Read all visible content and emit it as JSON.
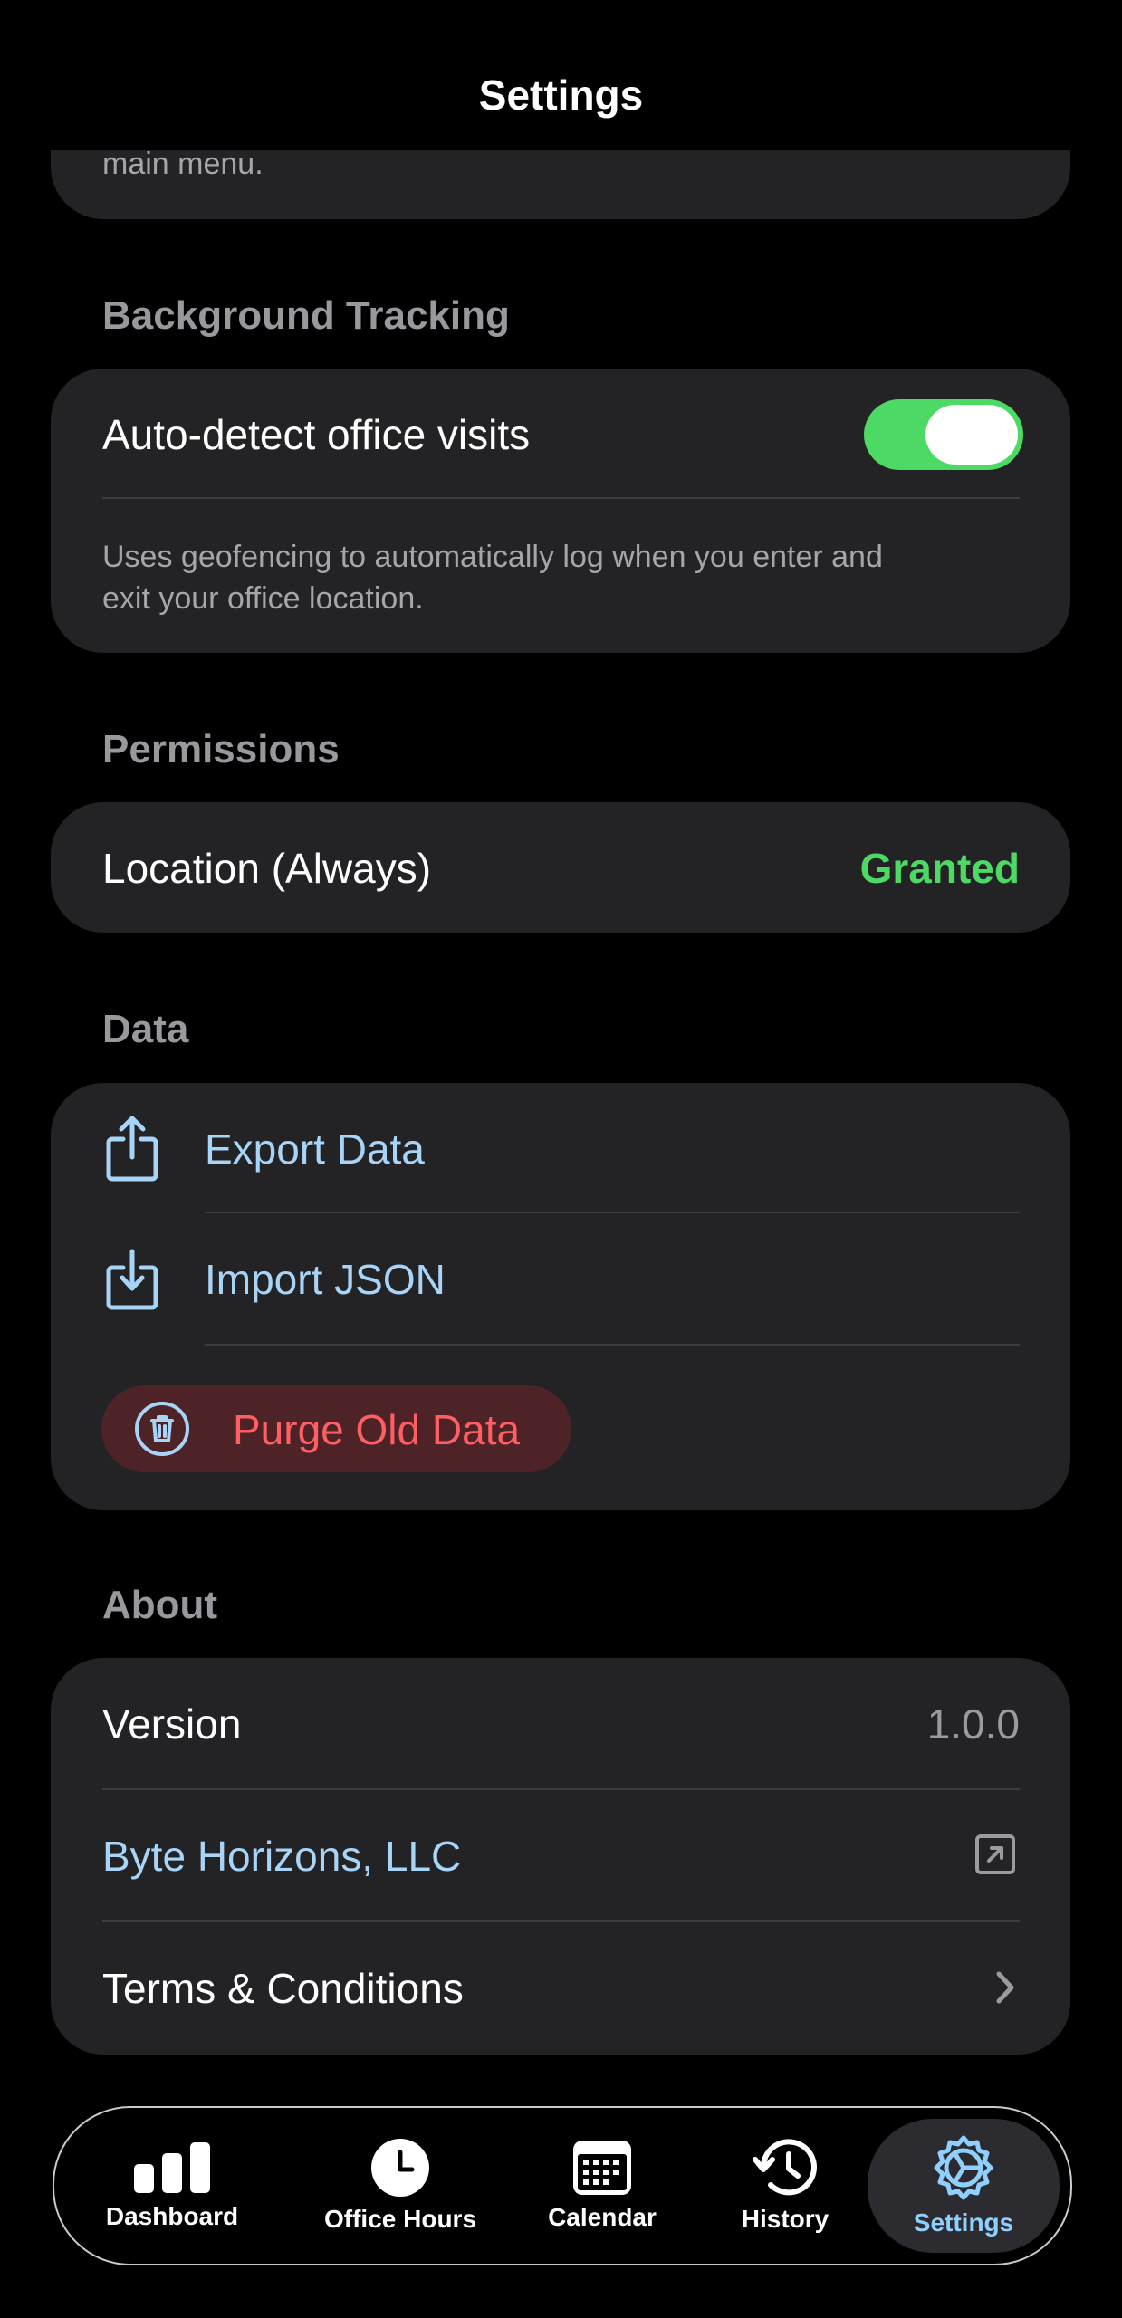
{
  "header": {
    "title": "Settings"
  },
  "top_card": {
    "clipped_text": "main menu."
  },
  "background_tracking": {
    "header": "Background Tracking",
    "toggle_label": "Auto-detect office visits",
    "toggle_on": true,
    "description_line1": "Uses geofencing to automatically log when you enter and",
    "description_line2": "exit your office location."
  },
  "permissions": {
    "header": "Permissions",
    "label": "Location (Always)",
    "status": "Granted",
    "status_color": "#4cd964"
  },
  "data": {
    "header": "Data",
    "export_label": "Export Data",
    "import_label": "Import JSON",
    "purge_label": "Purge Old Data"
  },
  "about": {
    "header": "About",
    "version_label": "Version",
    "version_value": "1.0.0",
    "company_label": "Byte Horizons, LLC",
    "terms_label": "Terms & Conditions"
  },
  "tabs": [
    {
      "label": "Dashboard",
      "icon": "bar-chart-icon"
    },
    {
      "label": "Office Hours",
      "icon": "clock-icon"
    },
    {
      "label": "Calendar",
      "icon": "calendar-icon"
    },
    {
      "label": "History",
      "icon": "history-icon"
    },
    {
      "label": "Settings",
      "icon": "gear-icon",
      "active": true
    }
  ],
  "colors": {
    "accent": "#a8d4f7",
    "danger": "#ff5f63",
    "success": "#4cd964",
    "card": "#232326"
  }
}
